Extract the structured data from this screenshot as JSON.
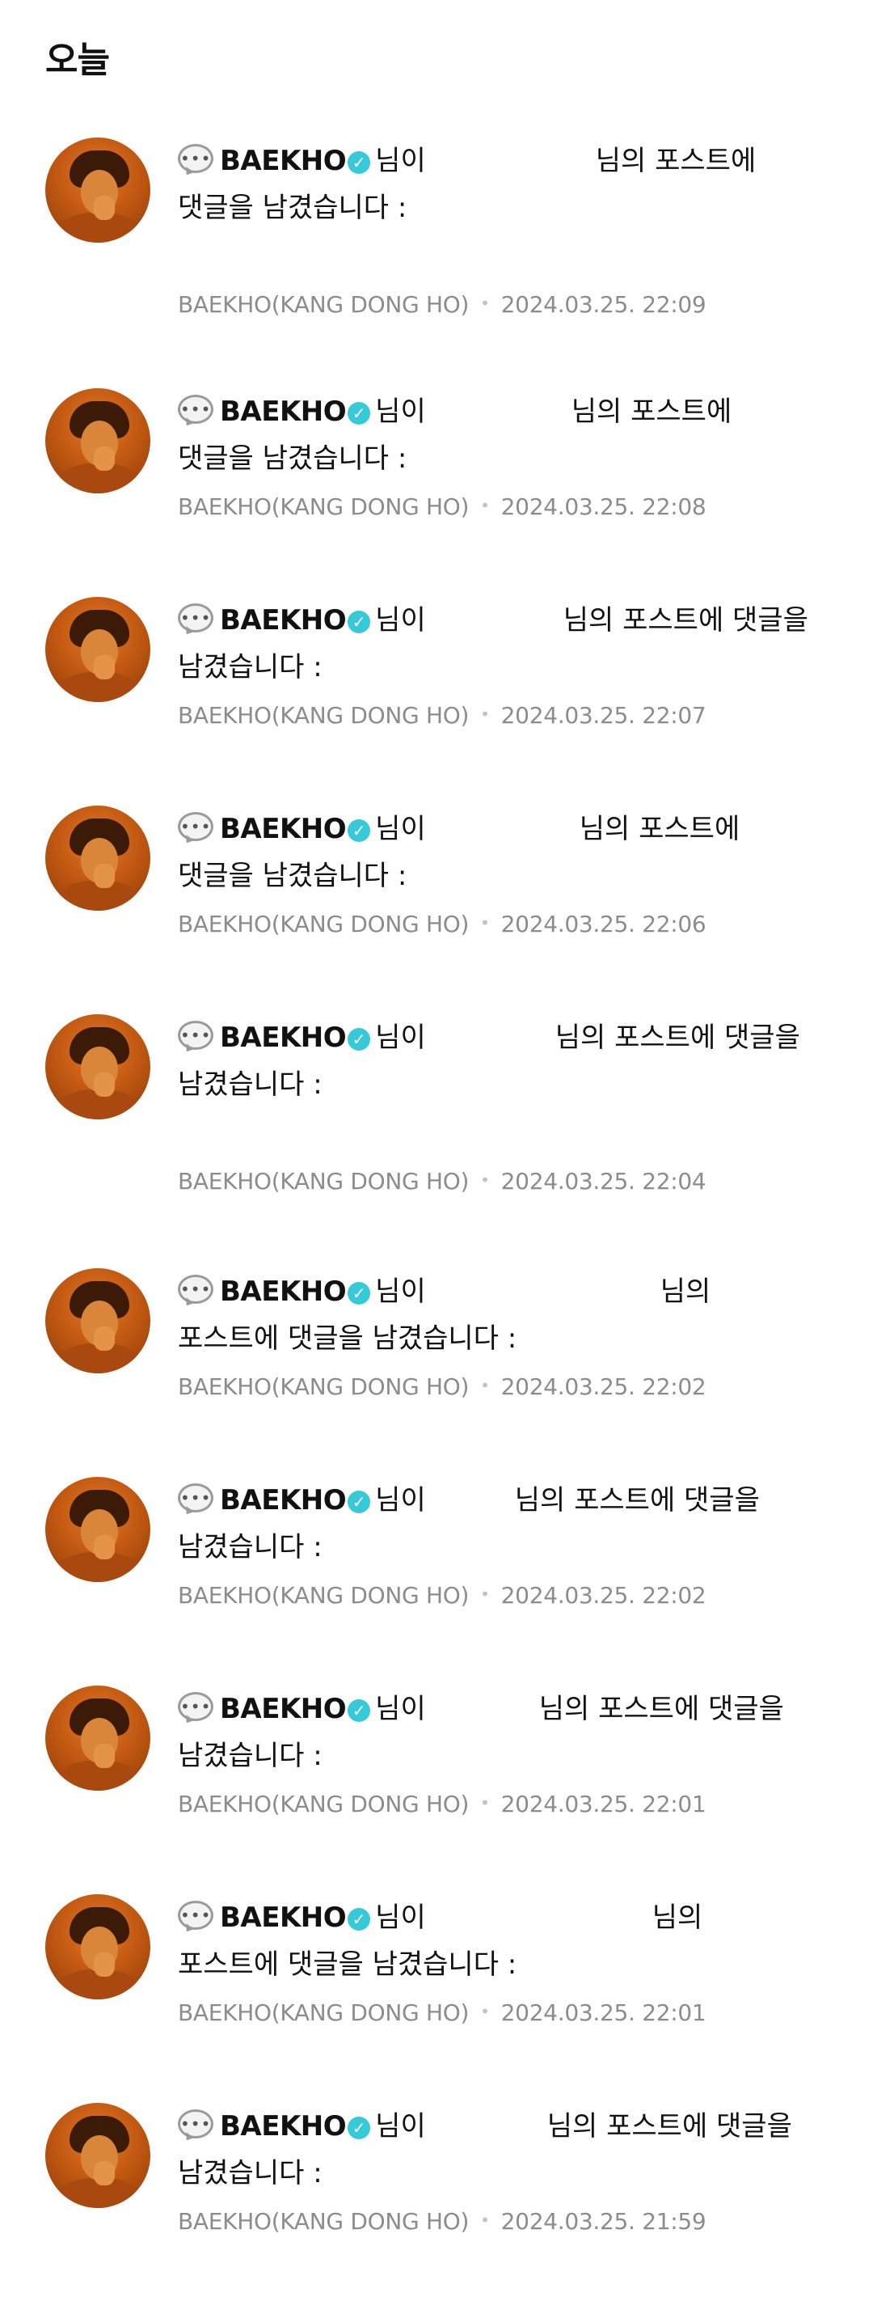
{
  "section_title": "오늘",
  "colors": {
    "verified": "#36c9d8",
    "meta_text": "#8c8c8c"
  },
  "icons": {
    "comment": "speech-bubble-icon",
    "verified": "verified-badge-icon"
  },
  "notifications": [
    {
      "user": "BAEKHO",
      "mid": "님이",
      "line1_tail": "님의 포스트에",
      "line2": "댓글을 남겼습니다 :",
      "source": "BAEKHO(KANG DONG HO)",
      "time": "2024.03.25. 22:09"
    },
    {
      "user": "BAEKHO",
      "mid": "님이",
      "line1_tail": "님의 포스트에",
      "line2": "댓글을 남겼습니다 :",
      "source": "BAEKHO(KANG DONG HO)",
      "time": "2024.03.25. 22:08"
    },
    {
      "user": "BAEKHO",
      "mid": "님이",
      "line1_tail": "님의 포스트에 댓글을",
      "line2": "남겼습니다 :",
      "source": "BAEKHO(KANG DONG HO)",
      "time": "2024.03.25. 22:07"
    },
    {
      "user": "BAEKHO",
      "mid": "님이",
      "line1_tail": "님의 포스트에",
      "line2": "댓글을 남겼습니다 :",
      "source": "BAEKHO(KANG DONG HO)",
      "time": "2024.03.25. 22:06"
    },
    {
      "user": "BAEKHO",
      "mid": "님이",
      "line1_tail": "님의 포스트에 댓글을",
      "line2": "남겼습니다 :",
      "source": "BAEKHO(KANG DONG HO)",
      "time": "2024.03.25. 22:04"
    },
    {
      "user": "BAEKHO",
      "mid": "님이",
      "line1_tail": "님의",
      "line2": "포스트에 댓글을 남겼습니다 :",
      "source": "BAEKHO(KANG DONG HO)",
      "time": "2024.03.25. 22:02"
    },
    {
      "user": "BAEKHO",
      "mid": "님이",
      "line1_tail": "님의 포스트에 댓글을",
      "line2": "남겼습니다 :",
      "source": "BAEKHO(KANG DONG HO)",
      "time": "2024.03.25. 22:02"
    },
    {
      "user": "BAEKHO",
      "mid": "님이",
      "line1_tail": "님의 포스트에 댓글을",
      "line2": "남겼습니다 :",
      "source": "BAEKHO(KANG DONG HO)",
      "time": "2024.03.25. 22:01"
    },
    {
      "user": "BAEKHO",
      "mid": "님이",
      "line1_tail": "님의",
      "line2": "포스트에 댓글을 남겼습니다 :",
      "source": "BAEKHO(KANG DONG HO)",
      "time": "2024.03.25. 22:01"
    },
    {
      "user": "BAEKHO",
      "mid": "님이",
      "line1_tail": "님의 포스트에 댓글을",
      "line2": "남겼습니다 :",
      "source": "BAEKHO(KANG DONG HO)",
      "time": "2024.03.25. 21:59"
    }
  ]
}
